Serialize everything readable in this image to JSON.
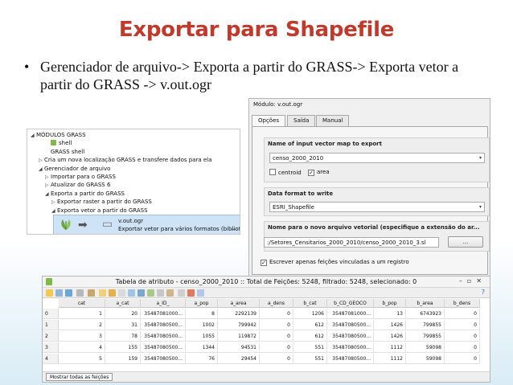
{
  "slide": {
    "title": "Exportar para Shapefile",
    "bullet": "Gerenciador de arquivo-> Exporta a partir do GRASS-> Exporta vetor a partir do GRASS -> v.out.ogr",
    "bullet_symbol": "•"
  },
  "tree": {
    "rows": [
      {
        "label": "MÓDULOS GRASS",
        "tri": "◢",
        "level": 0,
        "icon": "none"
      },
      {
        "label": "shell",
        "tri": "",
        "level": 2,
        "icon": "grass-icon"
      },
      {
        "label": "GRASS shell",
        "tri": "",
        "level": 2,
        "icon": "none"
      },
      {
        "label": "Cria um nova localização GRASS e transfere dados para ela",
        "tri": "▷",
        "level": 1,
        "icon": "none"
      },
      {
        "label": "Gerenciador de arquivo",
        "tri": "◢",
        "level": 1,
        "icon": "none"
      },
      {
        "label": "Importar para o GRASS",
        "tri": "▷",
        "level": 2,
        "icon": "none"
      },
      {
        "label": "Atualizar do GRASS 6",
        "tri": "▷",
        "level": 2,
        "icon": "none"
      },
      {
        "label": "Exporta a partir do GRASS",
        "tri": "◢",
        "level": 2,
        "icon": "none"
      },
      {
        "label": "Exportar raster a partir do GRASS",
        "tri": "▷",
        "level": 3,
        "icon": "none"
      },
      {
        "label": "Exporta vetor a partir do GRASS",
        "tri": "◢",
        "level": 3,
        "icon": "none"
      }
    ],
    "selected": {
      "name": "v.out.ogr",
      "description": "Exportar vetor para vários formatos (biblioteca ...",
      "arrow": "➡",
      "doc_icon": "▭"
    },
    "ellipsis": "..."
  },
  "dialog": {
    "title": "Módulo: v.out.ogr",
    "tabs": [
      "Opções",
      "Saída",
      "Manual"
    ],
    "input_group_label": "Name of input vector map to export",
    "input_value": "censo_2000_2010",
    "check_centroid": "centroid",
    "check_area": "area",
    "format_group_label": "Data format to write",
    "format_value": "ESRI_Shapefile",
    "output_group_label": "Nome para o novo arquivo vetorial (especifique a extensão do ar...",
    "output_value": ":/Setores_Censitarios_2000_2010/censo_2000_2010_3.sl",
    "browse_label": "...",
    "write_only_label": "Escrever apenas feições vinculadas a um registro",
    "check_mark": "✓",
    "caret": "▾"
  },
  "attr_table": {
    "title": "Tabela de atributo - censo_2000_2010 :: Total de Feições: 5248, filtrado: 5248, selecionado: 0",
    "window_buttons": "–▫✕",
    "headers": [
      "cat",
      "a_cat",
      "a_ID_",
      "a_pop",
      "a_area",
      "a_dens",
      "b_cat",
      "b_CD_GEOCO",
      "b_pop",
      "b_area",
      "b_dens"
    ],
    "rows": [
      {
        "id": "0",
        "cells": [
          "1",
          "20",
          "35487081000...",
          "8",
          "2292139",
          "0",
          "1206",
          "35487081000...",
          "13",
          "6743923",
          "0"
        ]
      },
      {
        "id": "1",
        "cells": [
          "2",
          "31",
          "35487080500...",
          "1002",
          "799942",
          "0",
          "612",
          "35487080500...",
          "1426",
          "799855",
          "0"
        ]
      },
      {
        "id": "2",
        "cells": [
          "3",
          "78",
          "35487080500...",
          "1055",
          "119872",
          "0",
          "612",
          "35487080500...",
          "1426",
          "799855",
          "0"
        ]
      },
      {
        "id": "3",
        "cells": [
          "4",
          "155",
          "35487080500...",
          "1344",
          "94531",
          "0",
          "551",
          "35487080500...",
          "1112",
          "59098",
          "0"
        ]
      },
      {
        "id": "4",
        "cells": [
          "5",
          "159",
          "35487080500...",
          "76",
          "29454",
          "0",
          "551",
          "35487080500...",
          "1112",
          "59098",
          "0"
        ]
      }
    ],
    "show_all_label": "Mostrar todas as feições",
    "help_icon": "?"
  },
  "colors": {
    "title": "#c0392b",
    "highlight": "#e01010",
    "selection": "#cfe3f6"
  }
}
